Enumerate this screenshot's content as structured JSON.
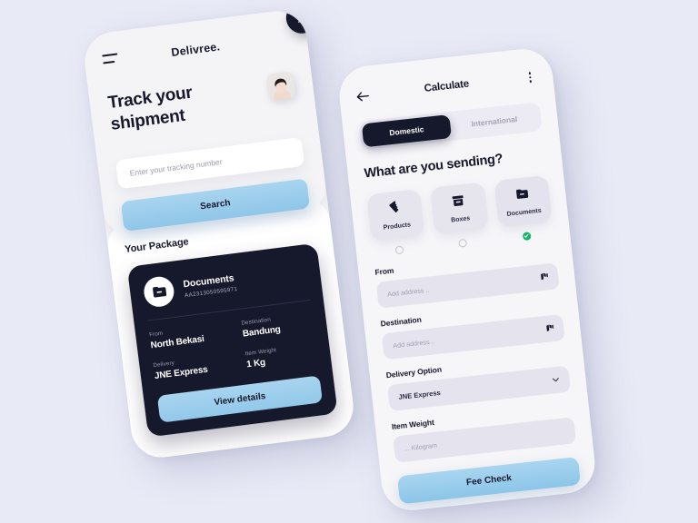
{
  "canvas": {
    "background_color": "#e8eaf6",
    "accent_blue": "#9acde9",
    "dark": "#16182b",
    "green": "#18b26a",
    "notification_red": "#ff4757"
  },
  "track_screen": {
    "brand": "Delivree.",
    "menu_icon": "hamburger-icon",
    "notification_icon": "bell-icon",
    "avatar_icon": "user-avatar",
    "heading": "Track your shipment",
    "tracking_input": {
      "placeholder": "Enter your tracking number",
      "value": ""
    },
    "search_label": "Search",
    "package_section_title": "Your Package",
    "package": {
      "type_icon": "folder-icon",
      "name": "Documents",
      "tracking_code": "AA2313050595971",
      "fields": [
        {
          "label": "From",
          "value": "North Bekasi"
        },
        {
          "label": "Destination",
          "value": "Bandung"
        },
        {
          "label": "Delivery",
          "value": "JNE Express"
        },
        {
          "label": "Item Weight",
          "value": "1 Kg"
        }
      ],
      "cta_label": "View details"
    }
  },
  "calculate_screen": {
    "back_icon": "arrow-left-icon",
    "title": "Calculate",
    "more_icon": "more-vertical-icon",
    "segments": [
      {
        "label": "Domestic",
        "active": true
      },
      {
        "label": "International",
        "active": false
      }
    ],
    "question": "What are you sending?",
    "categories": [
      {
        "label": "Products",
        "icon": "products-icon",
        "selected": false
      },
      {
        "label": "Boxes",
        "icon": "box-icon",
        "selected": false
      },
      {
        "label": "Documents",
        "icon": "folder-icon",
        "selected": true
      }
    ],
    "fields": [
      {
        "label": "From",
        "placeholder": "Add address ..",
        "value": "",
        "trailing_icon": "map-pin-icon"
      },
      {
        "label": "Destination",
        "placeholder": "Add address ..",
        "value": "",
        "trailing_icon": "map-pin-icon"
      },
      {
        "label": "Delivery Option",
        "placeholder": "",
        "value": "JNE Express",
        "trailing_icon": "chevron-down-icon"
      },
      {
        "label": "Item Weight",
        "placeholder": "... Kilogram",
        "value": "",
        "trailing_icon": ""
      }
    ],
    "cta_label": "Fee Check"
  }
}
